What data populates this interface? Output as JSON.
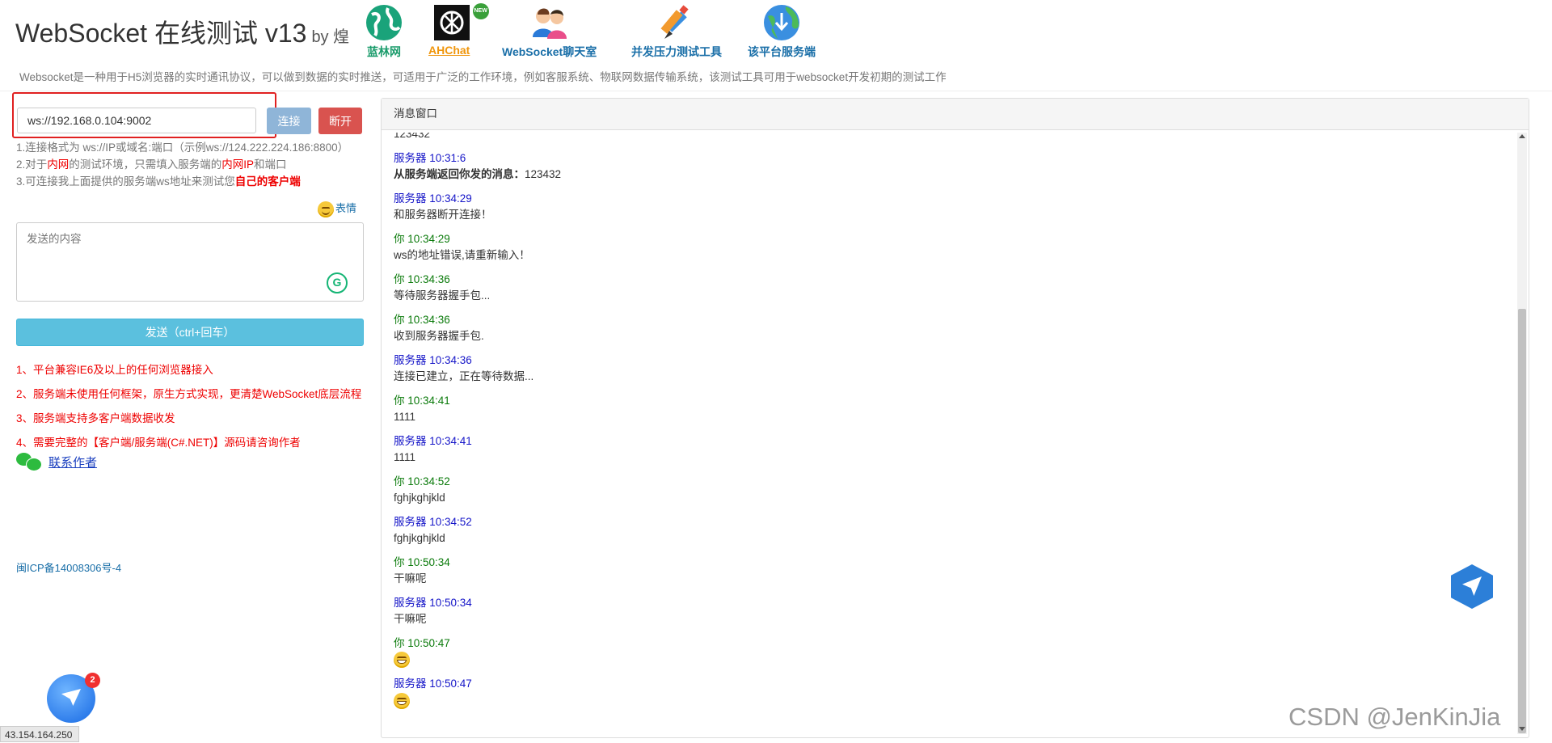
{
  "header": {
    "title": "WebSocket 在线测试 v13",
    "by": "by 煌",
    "subline": "Websocket是一种用于H5浏览器的实时通讯协议，可以做到数据的实时推送，可适用于广泛的工作环境，例如客服系统、物联网数据传输系统，该测试工具可用于websocket开发初期的测试工作",
    "nav": [
      {
        "label": "蓝林网",
        "icon": "globe-icon",
        "color": "#1a9b6b"
      },
      {
        "label": "AHChat",
        "icon": "openai-icon",
        "color": "#f0960c",
        "badge": "NEW"
      },
      {
        "label": "WebSocket聊天室",
        "icon": "chat-users-icon",
        "color": "#1a6fa8"
      },
      {
        "label": "并发压力测试工具",
        "icon": "pencil-tool-icon",
        "color": "#1a6fa8"
      },
      {
        "label": "该平台服务端",
        "icon": "earth-download-icon",
        "color": "#1a6fa8"
      }
    ]
  },
  "connection": {
    "url_value": "ws://192.168.0.104:9002",
    "connect_label": "连接",
    "disconnect_label": "断开"
  },
  "hints": {
    "line1": "1.连接格式为 ws://IP或域名:端口（示例ws://124.222.224.186:8800）",
    "line2_a": "2.对于",
    "line2_b": "内网",
    "line2_c": "的测试环境，只需填入服务端的",
    "line2_d": "内网IP",
    "line2_e": "和端口",
    "line3_a": "3.可连接我上面提供的服务端ws地址来测试您",
    "line3_b": "自己的客户端"
  },
  "composer": {
    "emoji_label": "表情",
    "placeholder": "发送的内容",
    "send_label": "发送（ctrl+回车）"
  },
  "features": [
    "1、平台兼容IE6及以上的任何浏览器接入",
    "2、服务端未使用任何框架，原生方式实现，更清楚WebSocket底层流程",
    "3、服务端支持多客户端数据收发",
    "4、需要完整的【客户端/服务端(C#.NET)】源码请咨询作者"
  ],
  "contact_label": "联系作者",
  "icp": "闽ICP备14008306号-4",
  "ip": "43.154.164.250",
  "notification_count": "2",
  "watermark": "CSDN @JenKinJia",
  "messages": {
    "title": "消息窗口",
    "top_partial": "123432",
    "items": [
      {
        "who": "服务器 10:31:6",
        "kind": "server",
        "text_bold": "从服务端返回你发的消息：",
        "text": "123432"
      },
      {
        "who": "服务器 10:34:29",
        "kind": "server",
        "text": "和服务器断开连接！"
      },
      {
        "who": "你 10:34:29",
        "kind": "you",
        "text": "ws的地址错误,请重新输入！"
      },
      {
        "who": "你 10:34:36",
        "kind": "you",
        "text": "等待服务器握手包..."
      },
      {
        "who": "你 10:34:36",
        "kind": "you",
        "text": "收到服务器握手包."
      },
      {
        "who": "服务器 10:34:36",
        "kind": "server",
        "text": "连接已建立，正在等待数据..."
      },
      {
        "who": "你 10:34:41",
        "kind": "you",
        "text": "1111"
      },
      {
        "who": "服务器 10:34:41",
        "kind": "server",
        "text": "1111"
      },
      {
        "who": "你 10:34:52",
        "kind": "you",
        "text": "fghjkghjkld"
      },
      {
        "who": "服务器 10:34:52",
        "kind": "server",
        "text": "fghjkghjkld"
      },
      {
        "who": "你 10:50:34",
        "kind": "you",
        "text": "干嘛呢"
      },
      {
        "who": "服务器 10:50:34",
        "kind": "server",
        "text": "干嘛呢"
      },
      {
        "who": "你 10:50:47",
        "kind": "you",
        "emoji": "grin-emoji"
      },
      {
        "who": "服务器 10:50:47",
        "kind": "server",
        "emoji": "grin-emoji"
      }
    ]
  }
}
